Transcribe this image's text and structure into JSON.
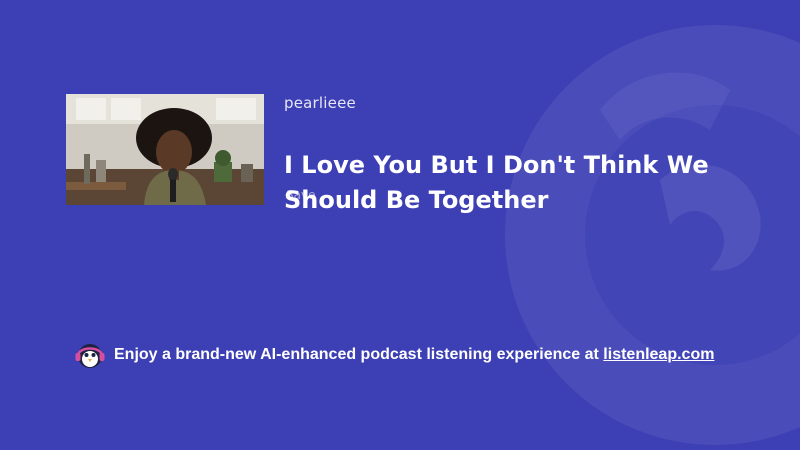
{
  "episode": {
    "author": "pearlieee",
    "title": "I Love You But I Don't Think We Should Be Together",
    "overlap_text": "Save"
  },
  "thumbnail": {
    "semantic": "woman-speaking-in-kitchen"
  },
  "promo": {
    "text": "Enjoy a brand-new AI-enhanced podcast listening experience at ",
    "link_text": "listenleap.com",
    "icon": "penguin-headphones-icon"
  },
  "colors": {
    "background": "#3d3fb4",
    "text": "#ffffff"
  }
}
